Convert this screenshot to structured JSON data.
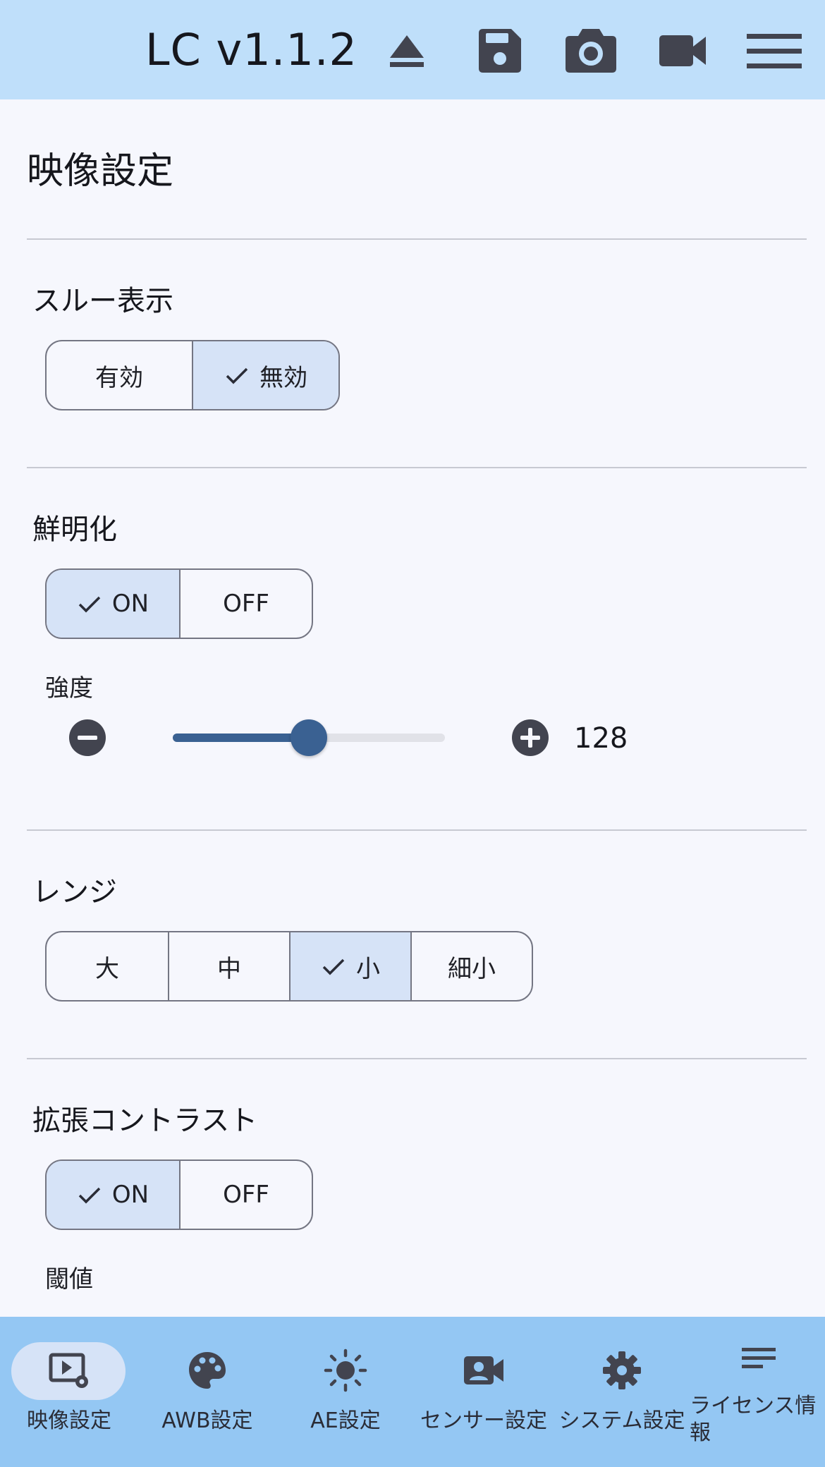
{
  "topbar": {
    "title": "LC v1.1.2",
    "icons": [
      "eject-icon",
      "save-icon",
      "camera-icon",
      "video-icon",
      "menu-icon"
    ]
  },
  "page": {
    "title": "映像設定"
  },
  "sections": {
    "thru": {
      "title": "スルー表示",
      "options": [
        "有効",
        "無効"
      ],
      "selected": "無効"
    },
    "sharpen": {
      "title": "鮮明化",
      "options": [
        "ON",
        "OFF"
      ],
      "selected": "ON",
      "strength_label": "強度",
      "strength_value": "128",
      "strength_fraction": 0.5
    },
    "range": {
      "title": "レンジ",
      "options": [
        "大",
        "中",
        "小",
        "細小"
      ],
      "selected": "小"
    },
    "contrast": {
      "title": "拡張コントラスト",
      "options": [
        "ON",
        "OFF"
      ],
      "selected": "ON",
      "threshold_label": "閾値"
    }
  },
  "bottom_nav": {
    "items": [
      {
        "label": "映像設定",
        "icon": "video-settings-icon",
        "active": true
      },
      {
        "label": "AWB設定",
        "icon": "palette-icon",
        "active": false
      },
      {
        "label": "AE設定",
        "icon": "brightness-icon",
        "active": false
      },
      {
        "label": "センサー設定",
        "icon": "sensor-camera-icon",
        "active": false
      },
      {
        "label": "システム設定",
        "icon": "gear-icon",
        "active": false
      },
      {
        "label": "ライセンス情報",
        "icon": "notes-icon",
        "active": false
      }
    ]
  },
  "colors": {
    "topbar": "#bfdffa",
    "bottombar": "#94c7f3",
    "selected": "#d6e3f7",
    "accent": "#3a6192",
    "icon": "#42444f"
  }
}
